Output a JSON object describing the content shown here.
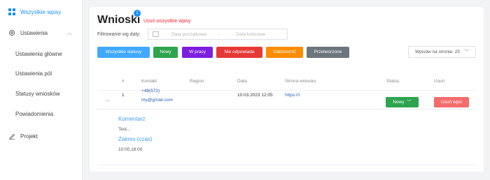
{
  "sidebar": {
    "items": [
      {
        "label": "Wszystkie wpisy"
      },
      {
        "label": "Ustawienia"
      },
      {
        "label": "Ustawienia główne"
      },
      {
        "label": "Ustawienia pól"
      },
      {
        "label": "Statusy wniosków"
      },
      {
        "label": "Powiadomienia"
      },
      {
        "label": "Projekt"
      }
    ]
  },
  "header": {
    "title": "Wnioski",
    "badge_count": "1",
    "clear_link": "Usuń wszystkie wpisy"
  },
  "filter": {
    "label": "Filtrowanie wg daty:",
    "start_placeholder": "Data początkowa",
    "separator": "-",
    "end_placeholder": "Data końcowa"
  },
  "status_buttons": [
    {
      "label": "Wszystkie statusy",
      "color": "#40a9ff"
    },
    {
      "label": "Nowy",
      "color": "#2ea44f"
    },
    {
      "label": "W pracy",
      "color": "#7b1fe0"
    },
    {
      "label": "Nie odpowiada",
      "color": "#e53935"
    },
    {
      "label": "Oddzwonić",
      "color": "#fb8c00"
    },
    {
      "label": "Przetworzone",
      "color": "#6c757d"
    }
  ],
  "per_page": {
    "label": "Wpisów na stronie: 25"
  },
  "table": {
    "headers": [
      "#",
      "Kontakt",
      "Region",
      "Data",
      "Strona wniosku",
      "Status",
      "Usuń"
    ],
    "rows": [
      {
        "id": "1",
        "phone": "+48(572)",
        "email": "my@gmail.com",
        "region": "",
        "date": "10.03.2023 12:05",
        "page": "https://i",
        "status": "Nowy",
        "delete": "Usuń wpis"
      }
    ]
  },
  "details": {
    "comment_label": "Komentarz",
    "comment_value": "Test...",
    "range_label": "Zakres (czas)",
    "range_value": "10:00,18:00"
  }
}
